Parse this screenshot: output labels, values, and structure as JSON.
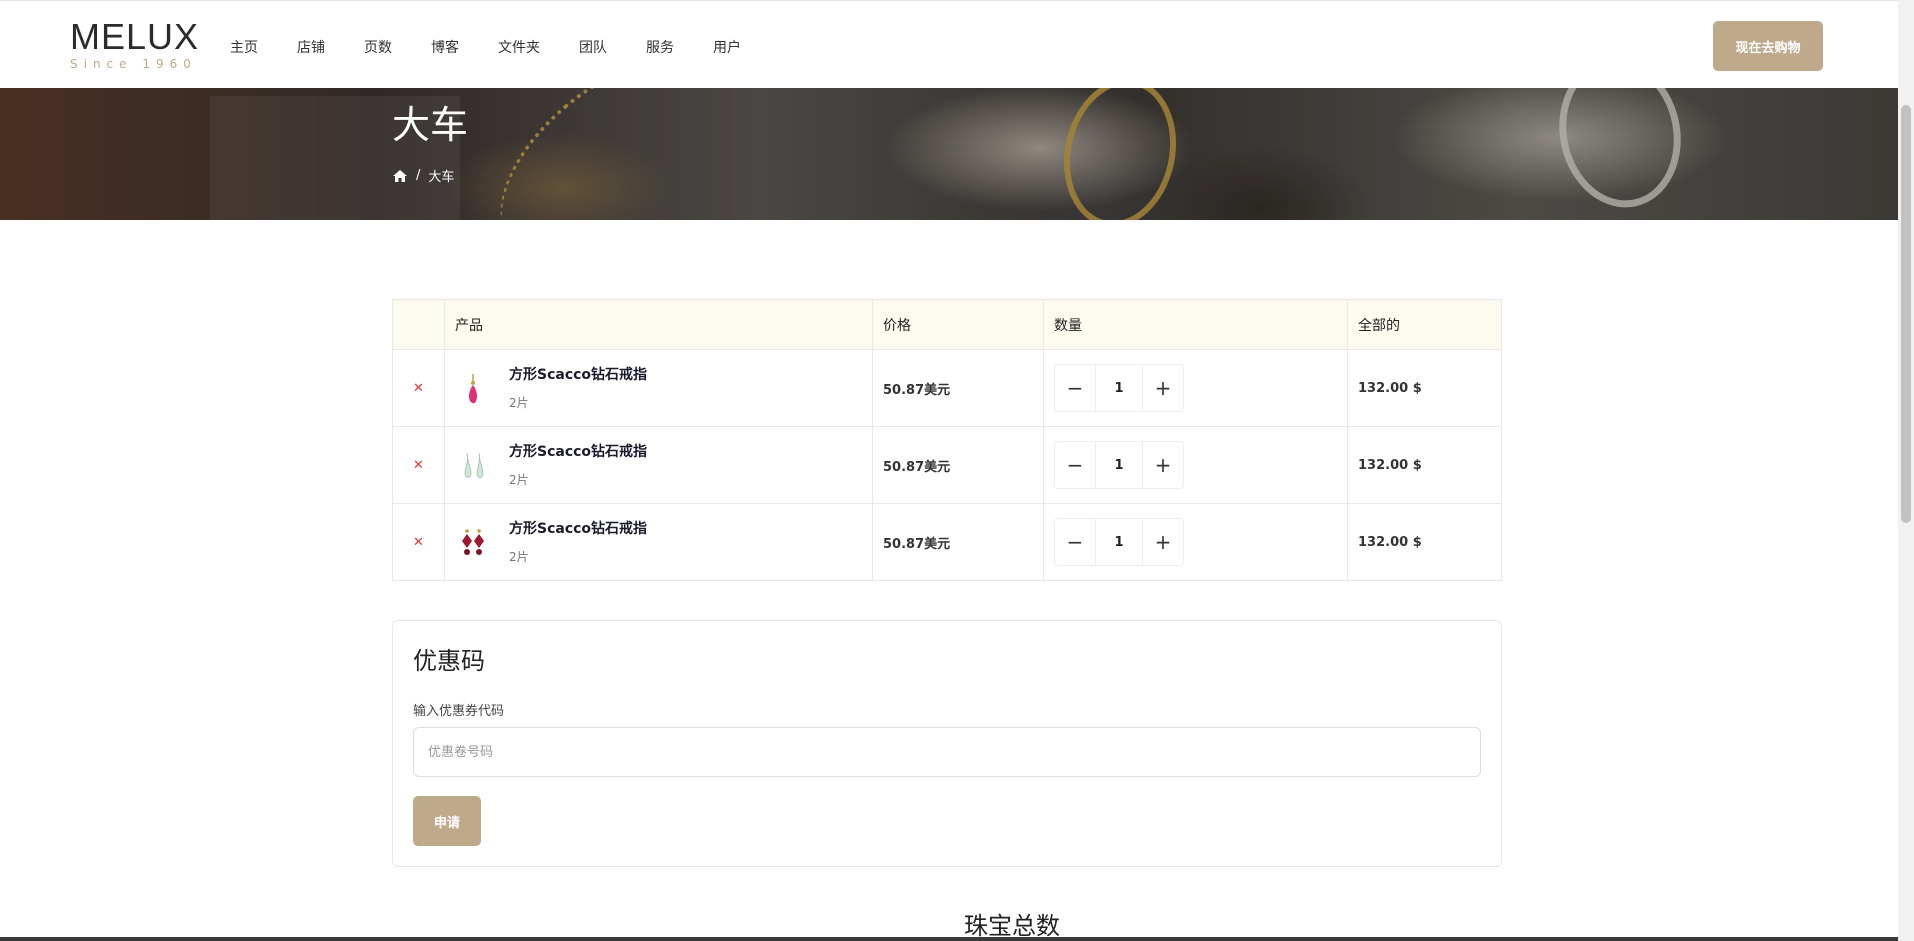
{
  "brand": {
    "name": "MELUX",
    "tagline": "Since 1960"
  },
  "nav": [
    "主页",
    "店铺",
    "页数",
    "博客",
    "文件夹",
    "团队",
    "服务",
    "用户"
  ],
  "header_cta": "现在去购物",
  "hero": {
    "title": "大车",
    "breadcrumb_sep": "/",
    "breadcrumb_current": "大车"
  },
  "cart": {
    "headers": [
      "",
      "产品",
      "价格",
      "数量",
      "全部的"
    ],
    "rows": [
      {
        "remove": "✕",
        "name": "方形Scacco钻石戒指",
        "meta": "2片",
        "price": "50.87美元",
        "qty": "1",
        "total": "132.00 $",
        "thumb_color": "#e0307a"
      },
      {
        "remove": "✕",
        "name": "方形Scacco钻石戒指",
        "meta": "2片",
        "price": "50.87美元",
        "qty": "1",
        "total": "132.00 $",
        "thumb_color": "#bfe0cc"
      },
      {
        "remove": "✕",
        "name": "方形Scacco钻石戒指",
        "meta": "2片",
        "price": "50.87美元",
        "qty": "1",
        "total": "132.00 $",
        "thumb_color": "#9b1b2c"
      }
    ],
    "minus": "−",
    "plus": "+"
  },
  "coupon": {
    "title": "优惠码",
    "label": "输入优惠券代码",
    "placeholder": "优惠卷号码",
    "apply": "申请"
  },
  "totals_title": "珠宝总数",
  "colors": {
    "accent": "#bea98b",
    "remove": "#e53935",
    "table_head_bg": "#fdfaf0"
  }
}
